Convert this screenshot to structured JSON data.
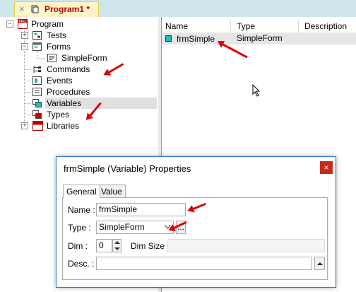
{
  "tab": {
    "close_glyph": "×",
    "title": "Program1 *"
  },
  "tree": {
    "items": [
      {
        "label": "Program",
        "icon": "program-prg-icon"
      },
      {
        "label": "Tests",
        "icon": "tests-icon"
      },
      {
        "label": "Forms",
        "icon": "forms-icon"
      },
      {
        "label": "SimpleForm",
        "icon": "form-icon"
      },
      {
        "label": "Commands",
        "icon": "commands-icon"
      },
      {
        "label": "Events",
        "icon": "events-icon"
      },
      {
        "label": "Procedures",
        "icon": "procedures-icon"
      },
      {
        "label": "Variables",
        "icon": "variables-icon"
      },
      {
        "label": "Types",
        "icon": "types-icon"
      },
      {
        "label": "Libraries",
        "icon": "libraries-icon"
      }
    ],
    "selected": "Variables",
    "expander_minus": "−",
    "expander_plus": "+"
  },
  "list": {
    "columns": [
      "Name",
      "Type",
      "Description"
    ],
    "rows": [
      {
        "name": "frmSimple",
        "type": "SimpleForm",
        "description": ""
      }
    ]
  },
  "dialog": {
    "title": "frmSimple (Variable) Properties",
    "close_glyph": "×",
    "tabs": [
      "General",
      "Value"
    ],
    "active_tab": "General",
    "name_label": "Name :",
    "name_value": "frmSimple",
    "type_label": "Type :",
    "type_value": "SimpleForm",
    "type_browse": "...",
    "dim_label": "Dim :",
    "dim_value": "0",
    "dimsize_label": "Dim Size :",
    "dimsize_value": "",
    "desc_label": "Desc. :",
    "desc_value": ""
  },
  "colors": {
    "accent_red": "#e00000",
    "tab_title": "#c00000",
    "dialog_border": "#2b7bd4"
  }
}
